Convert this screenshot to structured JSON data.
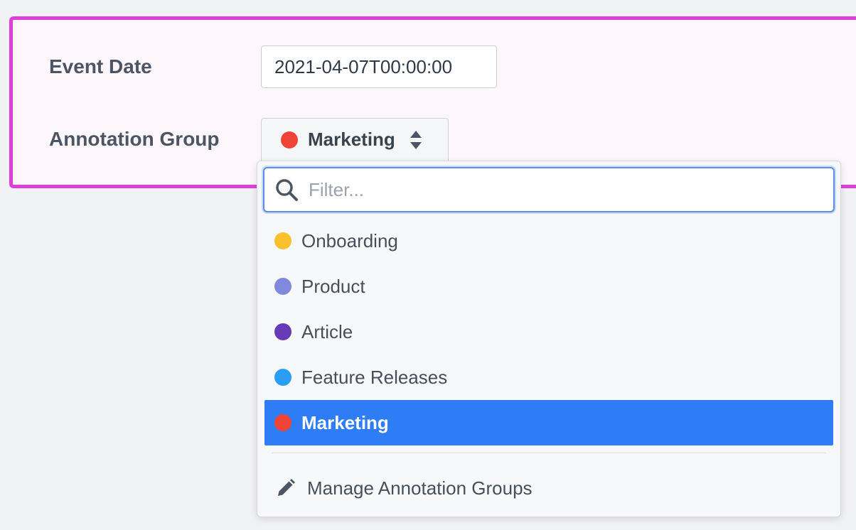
{
  "form": {
    "event_date_label": "Event Date",
    "event_date_value": "2021-04-07T00:00:00",
    "annotation_group_label": "Annotation Group",
    "selected_group": {
      "label": "Marketing",
      "color": "#f04437"
    }
  },
  "dropdown": {
    "filter_placeholder": "Filter...",
    "options": [
      {
        "label": "Onboarding",
        "color": "#fbc02d",
        "selected": false
      },
      {
        "label": "Product",
        "color": "#8189dc",
        "selected": false
      },
      {
        "label": "Article",
        "color": "#673ab7",
        "selected": false
      },
      {
        "label": "Feature Releases",
        "color": "#2a9df4",
        "selected": false
      },
      {
        "label": "Marketing",
        "color": "#f04437",
        "selected": true
      }
    ],
    "manage_label": "Manage Annotation Groups"
  },
  "colors": {
    "panel_border": "#e040d8",
    "selected_bg": "#2f7df6",
    "focus_border": "#5b8fe6"
  },
  "icons": {
    "search": "search-icon",
    "sort": "sort-icon",
    "pencil": "pencil-icon"
  }
}
